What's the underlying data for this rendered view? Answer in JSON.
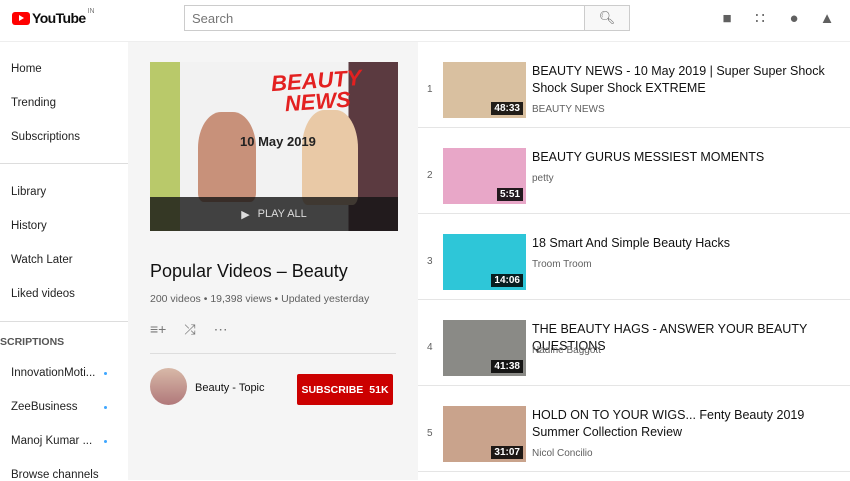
{
  "header": {
    "logo_text": "YouTube",
    "country": "IN",
    "search_placeholder": "Search"
  },
  "sidebar": {
    "items": [
      "Home",
      "Trending",
      "Subscriptions"
    ],
    "library": [
      "Library",
      "History",
      "Watch Later",
      "Liked videos"
    ],
    "subs_heading": "SCRIPTIONS",
    "subs": [
      "InnovationMoti...",
      "ZeeBusiness",
      "Manoj Kumar ..."
    ],
    "browse": "Browse channels"
  },
  "playlist": {
    "thumb_title": "BEAUTY NEWS",
    "thumb_date": "10 May 2019",
    "play_all": "PLAY ALL",
    "title": "Popular Videos – Beauty",
    "videos": "200 videos",
    "views": "19,398 views",
    "updated": "Updated yesterday",
    "owner": "Beauty - Topic",
    "subscribe": "SUBSCRIBE",
    "subs_count": "51K"
  },
  "videos": [
    {
      "index": "1",
      "title": "BEAUTY NEWS - 10 May 2019 | Super Super Shock Shock Super Shock EXTREME",
      "channel": "BEAUTY NEWS",
      "duration": "48:33",
      "color": "#d9c0a0"
    },
    {
      "index": "2",
      "title": "BEAUTY GURUS MESSIEST MOMENTS",
      "channel": "petty",
      "duration": "5:51",
      "color": "#e8a7c8"
    },
    {
      "index": "3",
      "title": "18 Smart And Simple Beauty Hacks",
      "channel": "Troom Troom",
      "duration": "14:06",
      "color": "#2ec6d8"
    },
    {
      "index": "4",
      "title": "THE BEAUTY HAGS - ANSWER YOUR BEAUTY QUESTIONS",
      "channel": "Nadine Baggott",
      "duration": "41:38",
      "color": "#8a8a86"
    },
    {
      "index": "5",
      "title": "HOLD ON TO YOUR WIGS... Fenty Beauty 2019 Summer Collection Review",
      "channel": "Nicol Concilio",
      "duration": "31:07",
      "color": "#c9a38c"
    }
  ]
}
